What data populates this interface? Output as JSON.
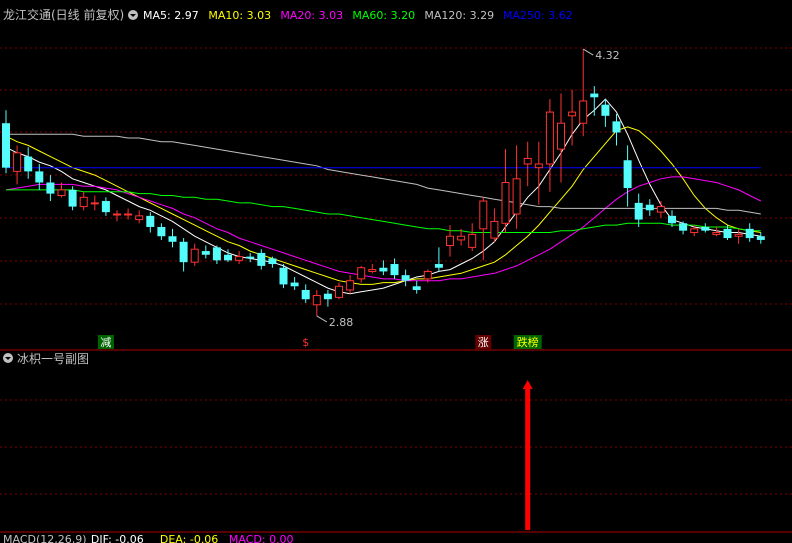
{
  "header": {
    "title": "龙江交通(日线 前复权)",
    "ma_items": [
      {
        "label": "MA5: 2.97",
        "color": "#ffffff"
      },
      {
        "label": "MA10: 3.03",
        "color": "#ffff00"
      },
      {
        "label": "MA20: 3.03",
        "color": "#ff00ff"
      },
      {
        "label": "MA60: 3.20",
        "color": "#00ff00"
      },
      {
        "label": "MA120: 3.29",
        "color": "#c0c0c0"
      },
      {
        "label": "MA250: 3.62",
        "color": "#0000ff"
      }
    ]
  },
  "sub_panel": {
    "title": "冰枳一号副图"
  },
  "footer": {
    "items": [
      {
        "label": "MACD(12,26,9)",
        "color": "#c0c0c0"
      },
      {
        "label": "DIF: -0.06",
        "color": "#ffffff"
      },
      {
        "label": "DEA: -0.06",
        "color": "#ffff00"
      },
      {
        "label": "MACD: 0.00",
        "color": "#ff00ff"
      }
    ]
  },
  "colors": {
    "up": "#ff3232",
    "down": "#54fcfc",
    "grid": "#800000",
    "arrow": "#ff0000"
  },
  "chart_data": {
    "type": "candlestick",
    "ylim": [
      2.75,
      4.45
    ],
    "annotations": {
      "high": {
        "label": "4.32",
        "value": 4.32,
        "index": 52
      },
      "low": {
        "label": "2.88",
        "value": 2.88,
        "index": 28
      }
    },
    "markers": [
      {
        "label": "减",
        "index": 9,
        "bg": "#006400",
        "fg": "#ffffff"
      },
      {
        "label": "$",
        "index": 27,
        "bg": "#000000",
        "fg": "#ff3232"
      },
      {
        "label": "涨",
        "index": 43,
        "bg": "#640000",
        "fg": "#ffffff"
      },
      {
        "label": "跌榜",
        "index": 47,
        "bg": "#006400",
        "fg": "#ffff00"
      }
    ],
    "candles": [
      [
        3.92,
        3.68,
        3.99,
        3.65
      ],
      [
        3.66,
        3.76,
        3.8,
        3.59
      ],
      [
        3.74,
        3.66,
        3.79,
        3.62
      ],
      [
        3.66,
        3.6,
        3.7,
        3.56
      ],
      [
        3.6,
        3.54,
        3.64,
        3.5
      ],
      [
        3.53,
        3.56,
        3.6,
        3.52
      ],
      [
        3.56,
        3.47,
        3.58,
        3.45
      ],
      [
        3.47,
        3.52,
        3.55,
        3.45
      ],
      [
        3.49,
        3.49,
        3.53,
        3.45
      ],
      [
        3.5,
        3.44,
        3.52,
        3.42
      ],
      [
        3.43,
        3.43,
        3.45,
        3.39
      ],
      [
        3.43,
        3.43,
        3.46,
        3.4
      ],
      [
        3.4,
        3.42,
        3.45,
        3.38
      ],
      [
        3.42,
        3.36,
        3.44,
        3.33
      ],
      [
        3.36,
        3.31,
        3.38,
        3.29
      ],
      [
        3.31,
        3.28,
        3.35,
        3.25
      ],
      [
        3.28,
        3.17,
        3.3,
        3.12
      ],
      [
        3.17,
        3.24,
        3.27,
        3.15
      ],
      [
        3.23,
        3.21,
        3.26,
        3.19
      ],
      [
        3.25,
        3.18,
        3.26,
        3.16
      ],
      [
        3.21,
        3.18,
        3.24,
        3.17
      ],
      [
        3.18,
        3.2,
        3.23,
        3.16
      ],
      [
        3.2,
        3.19,
        3.22,
        3.17
      ],
      [
        3.22,
        3.15,
        3.24,
        3.13
      ],
      [
        3.19,
        3.16,
        3.2,
        3.14
      ],
      [
        3.14,
        3.05,
        3.16,
        3.03
      ],
      [
        3.06,
        3.04,
        3.09,
        3.02
      ],
      [
        3.02,
        2.97,
        3.05,
        2.95
      ],
      [
        2.94,
        2.99,
        3.02,
        2.88
      ],
      [
        3.0,
        2.97,
        3.02,
        2.93
      ],
      [
        2.98,
        3.04,
        3.06,
        2.97
      ],
      [
        3.02,
        3.07,
        3.1,
        3.0
      ],
      [
        3.08,
        3.14,
        3.15,
        3.06
      ],
      [
        3.12,
        3.13,
        3.16,
        3.11
      ],
      [
        3.14,
        3.12,
        3.18,
        3.1
      ],
      [
        3.16,
        3.1,
        3.19,
        3.08
      ],
      [
        3.1,
        3.07,
        3.13,
        3.04
      ],
      [
        3.04,
        3.02,
        3.07,
        3.0
      ],
      [
        3.08,
        3.12,
        3.13,
        3.06
      ],
      [
        3.16,
        3.14,
        3.25,
        3.12
      ],
      [
        3.26,
        3.31,
        3.37,
        3.2
      ],
      [
        3.29,
        3.31,
        3.35,
        3.26
      ],
      [
        3.25,
        3.32,
        3.38,
        3.23
      ],
      [
        3.35,
        3.5,
        3.52,
        3.18
      ],
      [
        3.3,
        3.39,
        3.46,
        3.28
      ],
      [
        3.38,
        3.6,
        3.78,
        3.33
      ],
      [
        3.43,
        3.62,
        3.8,
        3.35
      ],
      [
        3.7,
        3.73,
        3.82,
        3.58
      ],
      [
        3.68,
        3.7,
        3.82,
        3.48
      ],
      [
        3.7,
        3.98,
        4.05,
        3.55
      ],
      [
        3.78,
        3.92,
        4.08,
        3.6
      ],
      [
        3.96,
        3.98,
        4.1,
        3.8
      ],
      [
        3.92,
        4.04,
        4.32,
        3.85
      ],
      [
        4.08,
        4.06,
        4.12,
        3.96
      ],
      [
        4.02,
        3.96,
        4.05,
        3.9
      ],
      [
        3.93,
        3.87,
        3.97,
        3.8
      ],
      [
        3.72,
        3.57,
        3.8,
        3.47
      ],
      [
        3.49,
        3.4,
        3.54,
        3.36
      ],
      [
        3.48,
        3.45,
        3.51,
        3.42
      ],
      [
        3.44,
        3.47,
        3.5,
        3.41
      ],
      [
        3.42,
        3.38,
        3.45,
        3.36
      ],
      [
        3.38,
        3.34,
        3.39,
        3.32
      ],
      [
        3.33,
        3.35,
        3.37,
        3.31
      ],
      [
        3.36,
        3.34,
        3.38,
        3.33
      ],
      [
        3.32,
        3.33,
        3.36,
        3.31
      ],
      [
        3.35,
        3.3,
        3.37,
        3.29
      ],
      [
        3.31,
        3.32,
        3.35,
        3.27
      ],
      [
        3.35,
        3.3,
        3.38,
        3.28
      ],
      [
        3.31,
        3.29,
        3.33,
        3.27
      ]
    ],
    "series": [
      {
        "name": "MA5",
        "color": "#ffffff",
        "values": [
          3.79,
          3.76,
          3.74,
          3.71,
          3.69,
          3.66,
          3.62,
          3.6,
          3.58,
          3.56,
          3.53,
          3.5,
          3.47,
          3.45,
          3.42,
          3.39,
          3.35,
          3.31,
          3.28,
          3.25,
          3.22,
          3.2,
          3.19,
          3.18,
          3.17,
          3.15,
          3.12,
          3.09,
          3.06,
          3.03,
          3.01,
          3.0,
          3.01,
          3.02,
          3.03,
          3.05,
          3.07,
          3.09,
          3.1,
          3.12,
          3.13,
          3.16,
          3.19,
          3.23,
          3.28,
          3.36,
          3.44,
          3.52,
          3.58,
          3.67,
          3.76,
          3.86,
          3.94,
          3.99,
          4.05,
          3.98,
          3.86,
          3.72,
          3.59,
          3.48,
          3.4,
          3.38,
          3.36,
          3.35,
          3.34,
          3.33,
          3.33,
          3.32,
          3.31
        ]
      },
      {
        "name": "MA10",
        "color": "#ffff00",
        "values": [
          3.85,
          3.82,
          3.8,
          3.77,
          3.74,
          3.71,
          3.68,
          3.66,
          3.64,
          3.61,
          3.58,
          3.55,
          3.52,
          3.49,
          3.46,
          3.43,
          3.4,
          3.37,
          3.34,
          3.31,
          3.28,
          3.26,
          3.23,
          3.21,
          3.19,
          3.17,
          3.15,
          3.13,
          3.11,
          3.09,
          3.07,
          3.06,
          3.05,
          3.05,
          3.06,
          3.06,
          3.07,
          3.08,
          3.08,
          3.09,
          3.1,
          3.11,
          3.13,
          3.15,
          3.17,
          3.21,
          3.26,
          3.31,
          3.37,
          3.44,
          3.51,
          3.58,
          3.67,
          3.74,
          3.81,
          3.88,
          3.9,
          3.88,
          3.83,
          3.77,
          3.7,
          3.62,
          3.53,
          3.46,
          3.41,
          3.37,
          3.35,
          3.34,
          3.33
        ]
      },
      {
        "name": "MA20",
        "color": "#ff00ff",
        "values": [
          3.56,
          3.57,
          3.58,
          3.59,
          3.59,
          3.59,
          3.59,
          3.58,
          3.58,
          3.57,
          3.56,
          3.54,
          3.52,
          3.5,
          3.48,
          3.46,
          3.43,
          3.41,
          3.38,
          3.35,
          3.33,
          3.3,
          3.28,
          3.26,
          3.24,
          3.22,
          3.2,
          3.18,
          3.16,
          3.14,
          3.12,
          3.11,
          3.1,
          3.09,
          3.08,
          3.08,
          3.07,
          3.07,
          3.07,
          3.07,
          3.08,
          3.08,
          3.09,
          3.1,
          3.11,
          3.13,
          3.15,
          3.18,
          3.21,
          3.24,
          3.28,
          3.32,
          3.36,
          3.41,
          3.46,
          3.51,
          3.55,
          3.58,
          3.6,
          3.62,
          3.63,
          3.63,
          3.62,
          3.61,
          3.6,
          3.58,
          3.56,
          3.53,
          3.5
        ]
      },
      {
        "name": "MA60",
        "color": "#00ff00",
        "values": [
          3.56,
          3.56,
          3.56,
          3.56,
          3.56,
          3.56,
          3.56,
          3.55,
          3.55,
          3.55,
          3.55,
          3.55,
          3.54,
          3.54,
          3.53,
          3.53,
          3.52,
          3.52,
          3.51,
          3.51,
          3.5,
          3.49,
          3.49,
          3.48,
          3.47,
          3.47,
          3.46,
          3.45,
          3.44,
          3.43,
          3.43,
          3.42,
          3.41,
          3.4,
          3.39,
          3.38,
          3.37,
          3.36,
          3.35,
          3.35,
          3.34,
          3.34,
          3.33,
          3.33,
          3.33,
          3.33,
          3.33,
          3.33,
          3.33,
          3.33,
          3.34,
          3.34,
          3.35,
          3.36,
          3.37,
          3.37,
          3.38,
          3.38,
          3.38,
          3.38,
          3.37,
          3.37,
          3.37,
          3.36,
          3.36,
          3.36,
          3.35,
          3.34,
          3.34
        ]
      },
      {
        "name": "MA120",
        "color": "#c0c0c0",
        "values": [
          3.86,
          3.86,
          3.86,
          3.86,
          3.86,
          3.86,
          3.86,
          3.85,
          3.85,
          3.85,
          3.85,
          3.84,
          3.84,
          3.83,
          3.82,
          3.82,
          3.81,
          3.8,
          3.79,
          3.78,
          3.77,
          3.76,
          3.75,
          3.74,
          3.73,
          3.72,
          3.71,
          3.7,
          3.69,
          3.67,
          3.66,
          3.65,
          3.64,
          3.63,
          3.62,
          3.61,
          3.6,
          3.59,
          3.57,
          3.56,
          3.55,
          3.54,
          3.53,
          3.52,
          3.51,
          3.5,
          3.49,
          3.48,
          3.47,
          3.47,
          3.46,
          3.46,
          3.46,
          3.46,
          3.46,
          3.46,
          3.46,
          3.46,
          3.46,
          3.46,
          3.46,
          3.46,
          3.46,
          3.46,
          3.46,
          3.45,
          3.45,
          3.44,
          3.43
        ]
      },
      {
        "name": "MA250",
        "color": "#0000ff",
        "values": [
          3.68,
          3.68,
          3.68,
          3.68,
          3.68,
          3.68,
          3.68,
          3.68,
          3.68,
          3.68,
          3.68,
          3.68,
          3.68,
          3.68,
          3.68,
          3.68,
          3.68,
          3.68,
          3.68,
          3.68,
          3.68,
          3.68,
          3.68,
          3.68,
          3.68,
          3.68,
          3.68,
          3.68,
          3.68,
          3.68,
          3.68,
          3.68,
          3.68,
          3.68,
          3.68,
          3.68,
          3.68,
          3.68,
          3.68,
          3.68,
          3.68,
          3.68,
          3.68,
          3.68,
          3.68,
          3.68,
          3.68,
          3.68,
          3.68,
          3.68,
          3.68,
          3.68,
          3.68,
          3.68,
          3.68,
          3.68,
          3.68,
          3.68,
          3.68,
          3.68,
          3.68,
          3.68,
          3.68,
          3.68,
          3.68,
          3.68,
          3.68,
          3.68,
          3.68
        ]
      }
    ],
    "sub_series": {
      "signal_index": 47,
      "value": 1
    }
  }
}
